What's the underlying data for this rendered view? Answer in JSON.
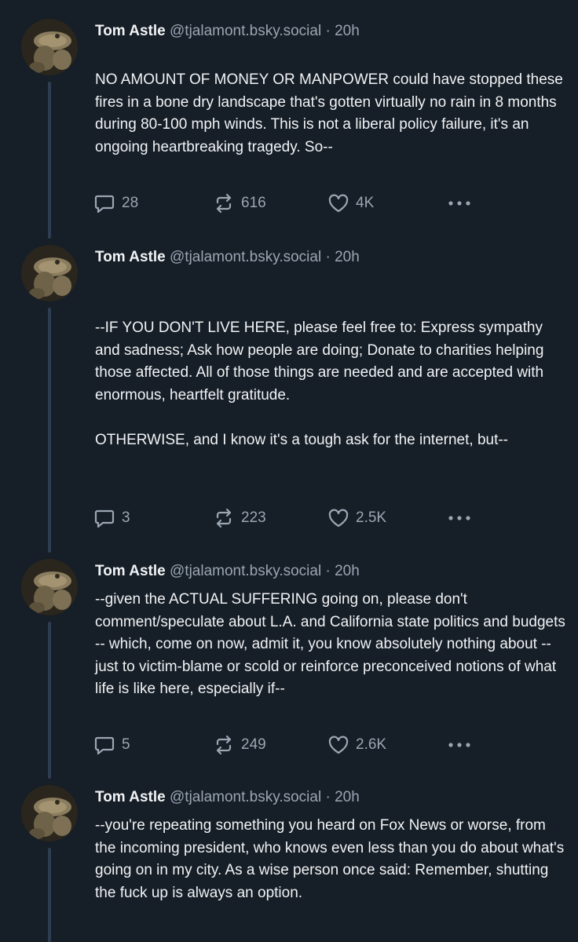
{
  "colors": {
    "background": "#161e27",
    "text": "#f1f3f5",
    "muted": "#9aa6b2",
    "thread_line": "#2e3e50"
  },
  "posts": [
    {
      "author": "Tom Astle",
      "handle": "@tjalamont.bsky.social",
      "separator": "·",
      "time": "20h",
      "text": "NO AMOUNT OF MONEY OR MANPOWER could have stopped these fires in a bone dry landscape that's gotten virtually no rain in 8 months during 80-100 mph winds. This is not a liberal policy failure, it's an ongoing heartbreaking tragedy. So--",
      "replies": "28",
      "reposts": "616",
      "likes": "4K"
    },
    {
      "author": "Tom Astle",
      "handle": "@tjalamont.bsky.social",
      "separator": "·",
      "time": "20h",
      "text": "--IF YOU DON'T LIVE HERE, please feel free to: Express sympathy and sadness; Ask how people are doing; Donate to charities helping those affected. All of those things are needed and are accepted with enormous, heartfelt gratitude.\n\nOTHERWISE, and I know it's a tough ask for the internet, but--",
      "replies": "3",
      "reposts": "223",
      "likes": "2.5K"
    },
    {
      "author": "Tom Astle",
      "handle": "@tjalamont.bsky.social",
      "separator": "·",
      "time": "20h",
      "text": "--given the ACTUAL SUFFERING going on, please don't comment/speculate about L.A. and California state politics and budgets -- which, come on now, admit it, you know absolutely nothing about -- just to victim-blame or scold or reinforce preconceived notions of what life is like here, especially if--",
      "replies": "5",
      "reposts": "249",
      "likes": "2.6K"
    },
    {
      "author": "Tom Astle",
      "handle": "@tjalamont.bsky.social",
      "separator": "·",
      "time": "20h",
      "text": "--you're repeating something you heard on Fox News or worse, from the incoming president, who knows even less than you do about what's going on in my city. As a wise person once said: Remember, shutting the fuck up is always an option."
    }
  ]
}
